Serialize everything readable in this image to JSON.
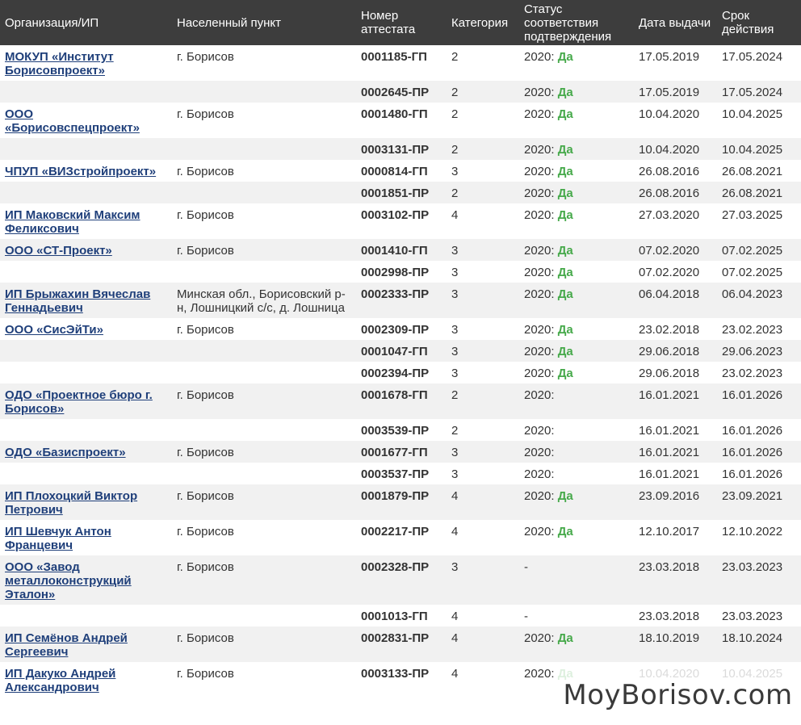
{
  "headers": [
    "Организация/ИП",
    "Населенный пункт",
    "Номер аттестата",
    "Категория",
    "Статус соответствия подтверждения",
    "Дата выдачи",
    "Срок действия"
  ],
  "rows": [
    {
      "org": "МОКУП «Институт Борисовпроект»",
      "place": "г. Борисов",
      "num": "0001185-ГП",
      "cat": "2",
      "year": "2020:",
      "status": "Да",
      "issued": "17.05.2019",
      "valid": "17.05.2024"
    },
    {
      "org": "",
      "place": "",
      "num": "0002645-ПР",
      "cat": "2",
      "year": "2020:",
      "status": "Да",
      "issued": "17.05.2019",
      "valid": "17.05.2024"
    },
    {
      "org": "ООО «Борисовспецпроект»",
      "place": "г. Борисов",
      "num": "0001480-ГП",
      "cat": "2",
      "year": "2020:",
      "status": "Да",
      "issued": "10.04.2020",
      "valid": "10.04.2025"
    },
    {
      "org": "",
      "place": "",
      "num": "0003131-ПР",
      "cat": "2",
      "year": "2020:",
      "status": "Да",
      "issued": "10.04.2020",
      "valid": "10.04.2025"
    },
    {
      "org": "ЧПУП «ВИЗстройпроект»",
      "place": "г. Борисов",
      "num": "0000814-ГП",
      "cat": "3",
      "year": "2020:",
      "status": "Да",
      "issued": "26.08.2016",
      "valid": "26.08.2021"
    },
    {
      "org": "",
      "place": "",
      "num": "0001851-ПР",
      "cat": "2",
      "year": "2020:",
      "status": "Да",
      "issued": "26.08.2016",
      "valid": "26.08.2021"
    },
    {
      "org": "ИП Маковский Максим Феликсович",
      "place": "г. Борисов",
      "num": "0003102-ПР",
      "cat": "4",
      "year": "2020:",
      "status": "Да",
      "issued": "27.03.2020",
      "valid": "27.03.2025"
    },
    {
      "org": "ООО «СТ-Проект»",
      "place": "г. Борисов",
      "num": "0001410-ГП",
      "cat": "3",
      "year": "2020:",
      "status": "Да",
      "issued": "07.02.2020",
      "valid": "07.02.2025"
    },
    {
      "org": "",
      "place": "",
      "num": "0002998-ПР",
      "cat": "3",
      "year": "2020:",
      "status": "Да",
      "issued": "07.02.2020",
      "valid": "07.02.2025"
    },
    {
      "org": "ИП Брыжахин Вячеслав Геннадьевич",
      "place": "Минская обл., Борисовский р-н, Лошницкий с/с, д. Лошница",
      "num": "0002333-ПР",
      "cat": "3",
      "year": "2020:",
      "status": "Да",
      "issued": "06.04.2018",
      "valid": "06.04.2023"
    },
    {
      "org": "ООО «СисЭйТи»",
      "place": "г. Борисов",
      "num": "0002309-ПР",
      "cat": "3",
      "year": "2020:",
      "status": "Да",
      "issued": "23.02.2018",
      "valid": "23.02.2023"
    },
    {
      "org": "",
      "place": "",
      "num": "0001047-ГП",
      "cat": "3",
      "year": "2020:",
      "status": "Да",
      "issued": "29.06.2018",
      "valid": "29.06.2023"
    },
    {
      "org": "",
      "place": "",
      "num": "0002394-ПР",
      "cat": "3",
      "year": "2020:",
      "status": "Да",
      "issued": "29.06.2018",
      "valid": "23.02.2023"
    },
    {
      "org": "ОДО «Проектное бюро г. Борисов»",
      "place": "г. Борисов",
      "num": "0001678-ГП",
      "cat": "2",
      "year": "2020:",
      "status": "",
      "issued": "16.01.2021",
      "valid": "16.01.2026"
    },
    {
      "org": "",
      "place": "",
      "num": "0003539-ПР",
      "cat": "2",
      "year": "2020:",
      "status": "",
      "issued": "16.01.2021",
      "valid": "16.01.2026"
    },
    {
      "org": "ОДО «Базиспроект»",
      "place": "г. Борисов",
      "num": "0001677-ГП",
      "cat": "3",
      "year": "2020:",
      "status": "",
      "issued": "16.01.2021",
      "valid": "16.01.2026"
    },
    {
      "org": "",
      "place": "",
      "num": "0003537-ПР",
      "cat": "3",
      "year": "2020:",
      "status": "",
      "issued": "16.01.2021",
      "valid": "16.01.2026"
    },
    {
      "org": "ИП Плохоцкий Виктор Петрович",
      "place": "г. Борисов",
      "num": "0001879-ПР",
      "cat": "4",
      "year": "2020:",
      "status": "Да",
      "issued": "23.09.2016",
      "valid": "23.09.2021"
    },
    {
      "org": "ИП Шевчук Антон Францевич",
      "place": "г. Борисов",
      "num": "0002217-ПР",
      "cat": "4",
      "year": "2020:",
      "status": "Да",
      "issued": "12.10.2017",
      "valid": "12.10.2022"
    },
    {
      "org": "ООО «Завод металлоконструкций Эталон»",
      "place": "г. Борисов",
      "num": "0002328-ПР",
      "cat": "3",
      "year": "-",
      "status": "",
      "issued": "23.03.2018",
      "valid": "23.03.2023"
    },
    {
      "org": "",
      "place": "",
      "num": "0001013-ГП",
      "cat": "4",
      "year": "-",
      "status": "",
      "issued": "23.03.2018",
      "valid": "23.03.2023"
    },
    {
      "org": "ИП Семёнов Андрей Сергеевич",
      "place": "г. Борисов",
      "num": "0002831-ПР",
      "cat": "4",
      "year": "2020:",
      "status": "Да",
      "issued": "18.10.2019",
      "valid": "18.10.2024"
    },
    {
      "org": "ИП Дакуко Андрей Александрович",
      "place": "г. Борисов",
      "num": "0003133-ПР",
      "cat": "4",
      "year": "2020:",
      "status": "Да",
      "issued": "10.04.2020",
      "valid": "10.04.2025"
    }
  ],
  "watermark": "MoyBorisov.com",
  "colors": {
    "header_bg": "#3d3d3d",
    "link": "#1f3f7a",
    "yes": "#46a94a",
    "stripe": "#f1f1f1"
  }
}
